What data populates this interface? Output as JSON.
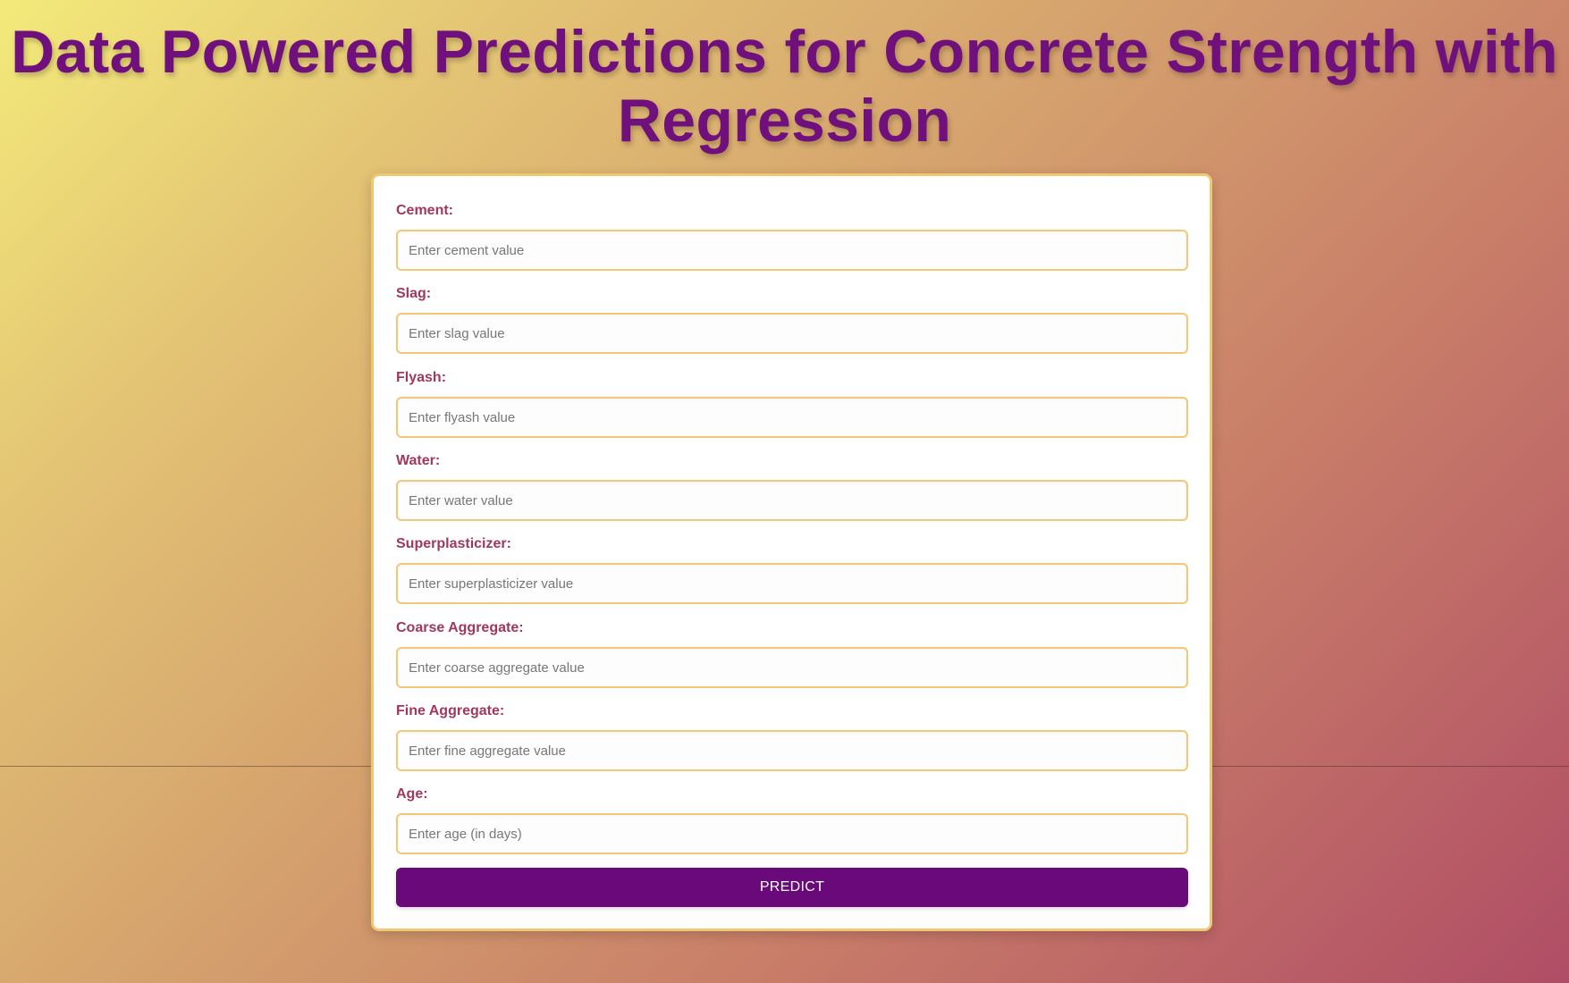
{
  "page": {
    "title": "Data Powered Predictions for Concrete Strength with Regression"
  },
  "form": {
    "fields": [
      {
        "label": "Cement:",
        "placeholder": "Enter cement value"
      },
      {
        "label": "Slag:",
        "placeholder": "Enter slag value"
      },
      {
        "label": "Flyash:",
        "placeholder": "Enter flyash value"
      },
      {
        "label": "Water:",
        "placeholder": "Enter water value"
      },
      {
        "label": "Superplasticizer:",
        "placeholder": "Enter superplasticizer value"
      },
      {
        "label": "Coarse Aggregate:",
        "placeholder": "Enter coarse aggregate value"
      },
      {
        "label": "Fine Aggregate:",
        "placeholder": "Enter fine aggregate value"
      },
      {
        "label": "Age:",
        "placeholder": "Enter age (in days)"
      }
    ],
    "submit_label": "PREDICT"
  },
  "colors": {
    "title": "#6f107d",
    "label": "#a1375d",
    "input_border": "#f0c877",
    "button": "#6a0a7a",
    "background_start": "#f3ea7a",
    "background_end": "#b04d66"
  }
}
